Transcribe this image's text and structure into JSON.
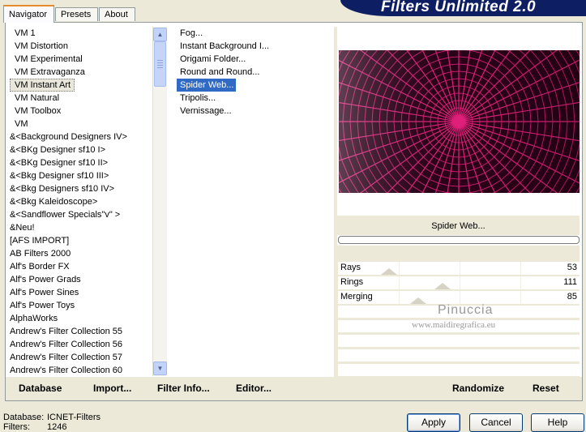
{
  "tabs": [
    "Navigator",
    "Presets",
    "About"
  ],
  "banner_title": "Filters Unlimited 2.0",
  "categories": [
    "VM 1",
    "VM Distortion",
    "VM Experimental",
    "VM Extravaganza",
    "VM Instant Art",
    "VM Natural",
    "VM Toolbox",
    "VM",
    "&<Background Designers IV>",
    "&<BKg Designer sf10 I>",
    "&<BKg Designer sf10 II>",
    "&<Bkg Designer sf10 III>",
    "&<Bkg Designers sf10 IV>",
    "&<Bkg Kaleidoscope>",
    "&<Sandflower Specials\"v\" >",
    "&Neu!",
    "[AFS IMPORT]",
    "AB Filters 2000",
    "Alf's Border FX",
    "Alf's Power Grads",
    "Alf's Power Sines",
    "Alf's Power Toys",
    "AlphaWorks",
    "Andrew's Filter Collection 55",
    "Andrew's Filter Collection 56",
    "Andrew's Filter Collection 57",
    "Andrew's Filter Collection 60"
  ],
  "selected_category": "VM Instant Art",
  "filters": [
    "Fog...",
    "Instant Background I...",
    "Origami Folder...",
    "Round and Round...",
    "Spider Web...",
    "Tripolis...",
    "Vernissage..."
  ],
  "selected_filter": "Spider Web...",
  "preview": {
    "filter_name": "Spider Web...",
    "colors": {
      "background": "#2a0018",
      "lines": "#e0207a"
    }
  },
  "sliders": [
    {
      "label": "Rays",
      "value": "53"
    },
    {
      "label": "Rings",
      "value": "111"
    },
    {
      "label": "Merging",
      "value": "85"
    }
  ],
  "watermark": {
    "name": "Pinuccia",
    "url": "www.maidiregrafica.eu"
  },
  "toolbar": {
    "database": "Database",
    "import": "Import...",
    "filter_info": "Filter Info...",
    "editor": "Editor...",
    "randomize": "Randomize",
    "reset": "Reset"
  },
  "status": {
    "database_label": "Database:",
    "database_value": "ICNET-Filters",
    "filters_label": "Filters:",
    "filters_value": "1246"
  },
  "buttons": {
    "apply": "Apply",
    "cancel": "Cancel",
    "help": "Help"
  }
}
